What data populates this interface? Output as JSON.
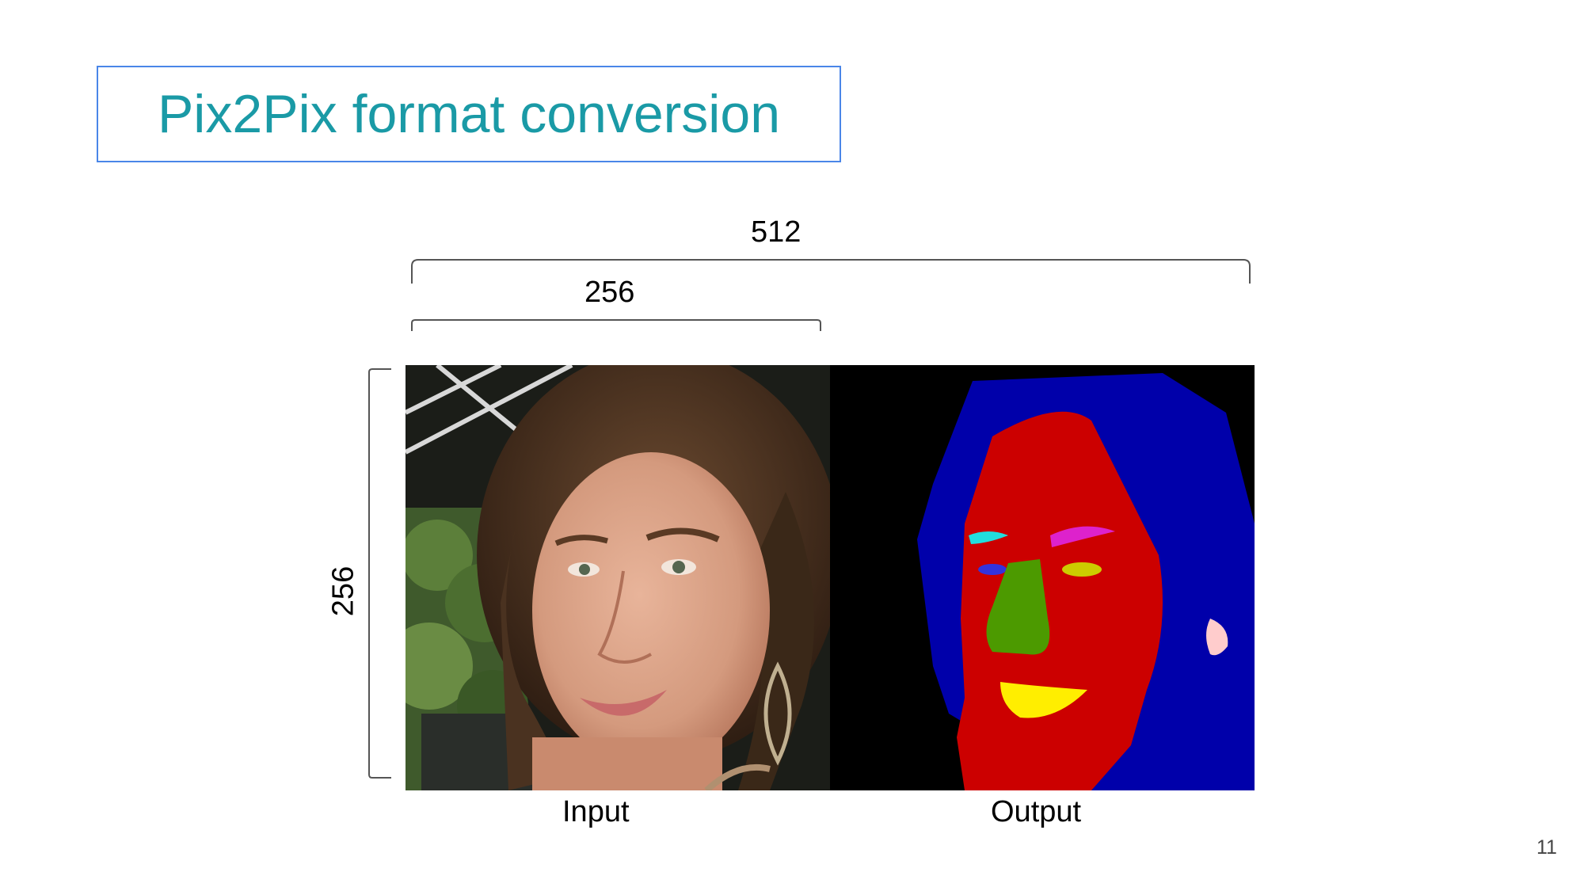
{
  "slide": {
    "title": "Pix2Pix format conversion",
    "page_number": "11"
  },
  "dimensions": {
    "total_width_label": "512",
    "single_width_label": "256",
    "height_label": "256"
  },
  "panels": {
    "input_label": "Input",
    "output_label": "Output"
  },
  "colors": {
    "title": "#1a9aa6",
    "title_border": "#4a86e8",
    "segmentation_skin": "#cc0000",
    "segmentation_hair": "#0000aa",
    "segmentation_nose": "#4c9a00",
    "segmentation_lips": "#ffee00",
    "segmentation_brow_left": "#22dddd",
    "segmentation_brow_right": "#dd22cc",
    "segmentation_eye_left": "#3333dd",
    "segmentation_eye_right": "#cccc00",
    "segmentation_ear": "#ffcccc"
  }
}
